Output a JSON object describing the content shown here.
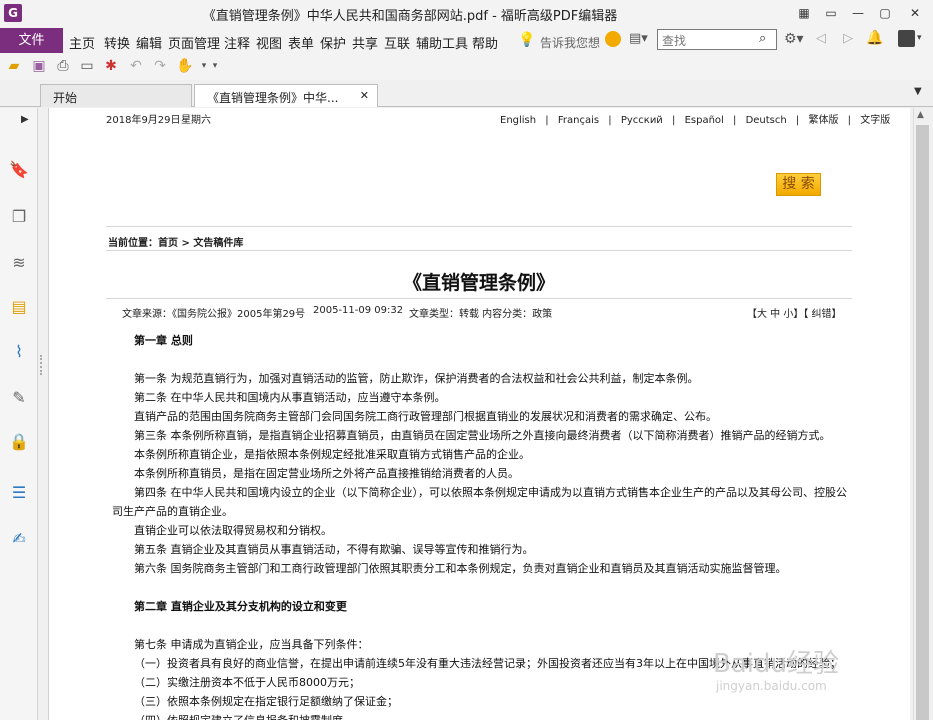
{
  "window": {
    "title": "《直销管理条例》中华人民共和国商务部网站.pdf - 福昕高级PDF编辑器",
    "logo_letter": "G",
    "buttons": [
      "▦",
      "▭",
      "—",
      "▢",
      "✕"
    ]
  },
  "menu": {
    "file": "文件",
    "items": [
      "主页",
      "转换",
      "编辑",
      "页面管理",
      "注释",
      "视图",
      "表单",
      "保护",
      "共享",
      "互联",
      "辅助工具",
      "帮助"
    ],
    "tell_me": "告诉我您想",
    "search_placeholder": "查找"
  },
  "tabs": [
    {
      "label": "开始"
    },
    {
      "label": "《直销管理条例》中华...",
      "close": "✕"
    }
  ],
  "page": {
    "date": "2018年9月29日",
    "weekday": "星期六",
    "languages": [
      "English",
      "|",
      "Français",
      "|",
      "Русский",
      "|",
      "Español",
      "|",
      "Deutsch",
      "|",
      "繁体版",
      "|",
      "文字版"
    ],
    "search_button": "搜 索",
    "breadcrumb": "当前位置：首页 >  文告稿件库",
    "title": "《直销管理条例》",
    "meta": {
      "source": "文章来源：《国务院公报》2005年第29号",
      "time": "2005-11-09 09:32",
      "type": "文章类型：转载    内容分类：政策",
      "size_controls": "【大 中 小】【 纠错】"
    },
    "lines": [
      {
        "text": "第一章 总则",
        "bold": true
      },
      {
        "text": ""
      },
      {
        "text": "第一条 为规范直销行为，加强对直销活动的监管，防止欺诈，保护消费者的合法权益和社会公共利益，制定本条例。"
      },
      {
        "text": "第二条 在中华人民共和国境内从事直销活动，应当遵守本条例。"
      },
      {
        "text": "直销产品的范围由国务院商务主管部门会同国务院工商行政管理部门根据直销业的发展状况和消费者的需求确定、公布。"
      },
      {
        "text": "第三条 本条例所称直销，是指直销企业招募直销员，由直销员在固定营业场所之外直接向最终消费者（以下简称消费者）推销产品的经销方式。"
      },
      {
        "text": "本条例所称直销企业，是指依照本条例规定经批准采取直销方式销售产品的企业。"
      },
      {
        "text": "本条例所称直销员，是指在固定营业场所之外将产品直接推销给消费者的人员。"
      },
      {
        "text": "第四条 在中华人民共和国境内设立的企业（以下简称企业），可以依照本条例规定申请成为以直销方式销售本企业生产的产品以及其母公司、控股公"
      },
      {
        "text": "司生产产品的直销企业。",
        "outdent": true
      },
      {
        "text": "直销企业可以依法取得贸易权和分销权。"
      },
      {
        "text": "第五条 直销企业及其直销员从事直销活动，不得有欺骗、误导等宣传和推销行为。"
      },
      {
        "text": "第六条 国务院商务主管部门和工商行政管理部门依照其职责分工和本条例规定，负责对直销企业和直销员及其直销活动实施监督管理。"
      },
      {
        "text": ""
      },
      {
        "text": "第二章 直销企业及其分支机构的设立和变更",
        "bold": true
      },
      {
        "text": ""
      },
      {
        "text": "第七条 申请成为直销企业，应当具备下列条件："
      },
      {
        "text": "（一）投资者具有良好的商业信誉，在提出申请前连续5年没有重大违法经营记录；外国投资者还应当有3年以上在中国境外从事直销活动的经验；"
      },
      {
        "text": "（二）实缴注册资本不低于人民币8000万元；"
      },
      {
        "text": "（三）依照本条例规定在指定银行足额缴纳了保证金；"
      },
      {
        "text": "（四）依照规定建立了信息报备和披露制度。"
      }
    ]
  },
  "watermark": {
    "main": "Baidu经验",
    "sub": "jingyan.baidu.com"
  }
}
